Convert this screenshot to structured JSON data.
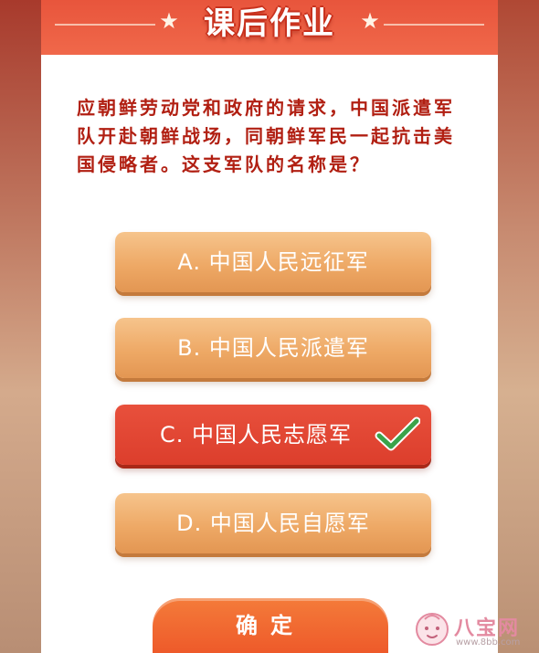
{
  "header": {
    "title": "课后作业",
    "star_glyph": "★"
  },
  "question": {
    "text": "应朝鲜劳动党和政府的请求，中国派遣军队开赴朝鲜战场，同朝鲜军民一起抗击美国侵略者。这支军队的名称是？"
  },
  "options": [
    {
      "label": "A. 中国人民远征军",
      "state": "normal"
    },
    {
      "label": "B. 中国人民派遣军",
      "state": "normal"
    },
    {
      "label": "C. 中国人民志愿军",
      "state": "correct",
      "indicator_icon": "checkmark-icon"
    },
    {
      "label": "D. 中国人民自愿军",
      "state": "normal"
    }
  ],
  "confirm_button": {
    "label": "确定"
  },
  "watermark": {
    "brand": "八宝网",
    "url": "www.8bb.com"
  },
  "colors": {
    "header_red": "#e8553c",
    "question_text": "#b11f12",
    "option_orange": "#eea966",
    "option_correct": "#dc3e2c",
    "check_green": "#3aa34a",
    "confirm_orange": "#f0652e"
  }
}
